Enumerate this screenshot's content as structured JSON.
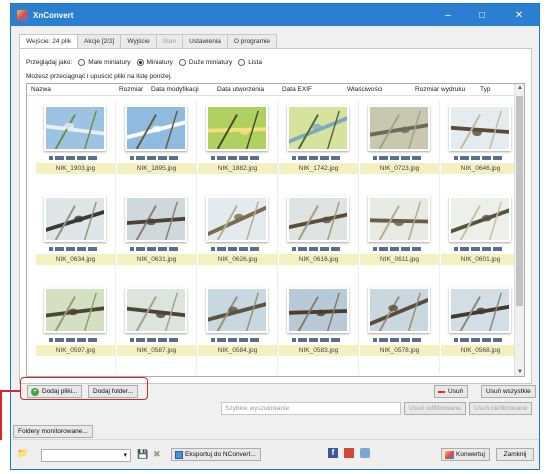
{
  "window": {
    "title": "XnConvert"
  },
  "tabs": [
    {
      "label": "Wejście: 24 plik",
      "active": true,
      "disabled": false
    },
    {
      "label": "Akcje [2/2]",
      "active": false,
      "disabled": false
    },
    {
      "label": "Wyjście",
      "active": false,
      "disabled": false
    },
    {
      "label": "Stan",
      "active": false,
      "disabled": true
    },
    {
      "label": "Ustawienia",
      "active": false,
      "disabled": false
    },
    {
      "label": "O programie",
      "active": false,
      "disabled": false
    }
  ],
  "view": {
    "label": "Przeglądaj jako:",
    "options": [
      "Małe miniatury",
      "Miniatury",
      "Duże miniatury",
      "Lista"
    ],
    "selected": "Miniatury"
  },
  "hint": "Możesz przeciągnąć i upuścić pliki na listę poniżej.",
  "columns": [
    "Nazwa",
    "Rozmiar",
    "Data modyfikacji",
    "Data utworzenia",
    "Data EXIF",
    "Właściwości",
    "Rozmiar wydruku",
    "Typ"
  ],
  "files": [
    {
      "name": "NIK_1903.jpg",
      "palette": [
        "#9cc3e4",
        "#e9eff6",
        "#6d8f3a"
      ]
    },
    {
      "name": "NIK_1895.jpg",
      "palette": [
        "#8fbbe0",
        "#ffffff",
        "#6a5a3a"
      ]
    },
    {
      "name": "NIK_1882.jpg",
      "palette": [
        "#b0d060",
        "#f5e07c",
        "#4a4a2a"
      ]
    },
    {
      "name": "NIK_1742.jpg",
      "palette": [
        "#d7e39c",
        "#7fa8c7",
        "#4f6a3a"
      ]
    },
    {
      "name": "NIK_0723.jpg",
      "palette": [
        "#c8c8b0",
        "#6b6b5a",
        "#a0a090"
      ]
    },
    {
      "name": "NIK_0646.jpg",
      "palette": [
        "#e5ecef",
        "#5a4a3a",
        "#c4b8a0"
      ]
    },
    {
      "name": "NIK_0634.jpg",
      "palette": [
        "#dfe6e8",
        "#3b3a34",
        "#9a9280"
      ]
    },
    {
      "name": "NIK_0631.jpg",
      "palette": [
        "#cfd9dc",
        "#4a4238",
        "#8a8070"
      ]
    },
    {
      "name": "NIK_0626.jpg",
      "palette": [
        "#e4ebee",
        "#7a6a50",
        "#b9ad93"
      ]
    },
    {
      "name": "NIK_0616.jpg",
      "palette": [
        "#dde4e2",
        "#5b4d3a",
        "#a69a84"
      ]
    },
    {
      "name": "NIK_0611.jpg",
      "palette": [
        "#e8ebe3",
        "#6a5c46",
        "#b6aa8d"
      ]
    },
    {
      "name": "NIK_0601.jpg",
      "palette": [
        "#edf0ea",
        "#5a5040",
        "#c7bfa8"
      ]
    },
    {
      "name": "NIK_0597.jpg",
      "palette": [
        "#d4e0c2",
        "#4c4637",
        "#9b9a70"
      ]
    },
    {
      "name": "NIK_0587.jpg",
      "palette": [
        "#dbe4dd",
        "#4b4436",
        "#a7a08c"
      ]
    },
    {
      "name": "NIK_0584.jpg",
      "palette": [
        "#c7d8e0",
        "#5d5140",
        "#9c8f74"
      ]
    },
    {
      "name": "NIK_0583.jpg",
      "palette": [
        "#b8cad8",
        "#4a3e30",
        "#8a7c66"
      ]
    },
    {
      "name": "NIK_0578.jpg",
      "palette": [
        "#c9d7df",
        "#5a4c3c",
        "#9a8c76"
      ]
    },
    {
      "name": "NIK_0568.jpg",
      "palette": [
        "#d2dde6",
        "#3f3a32",
        "#8d8575"
      ]
    }
  ],
  "buttons": {
    "add_files": "Dodaj pliki...",
    "add_folder": "Dodaj folder...",
    "remove": "Usuń",
    "remove_all": "Usuń wszystkie",
    "remove_filtered": "Usuń odfiltrowane",
    "remove_unfiltered": "Usuń niefiltrowane",
    "watch_folders": "Foldery monitorowane...",
    "export_nconvert": "Eksportuj do NConvert...",
    "convert": "Konwertuj",
    "close": "Zamknij"
  },
  "search": {
    "placeholder": "Szybkie wyszukiwanie"
  },
  "colors": {
    "titlebar": "#2b7fd0",
    "highlight": "#d9262b",
    "filename_bg": "#f2f1bf"
  }
}
